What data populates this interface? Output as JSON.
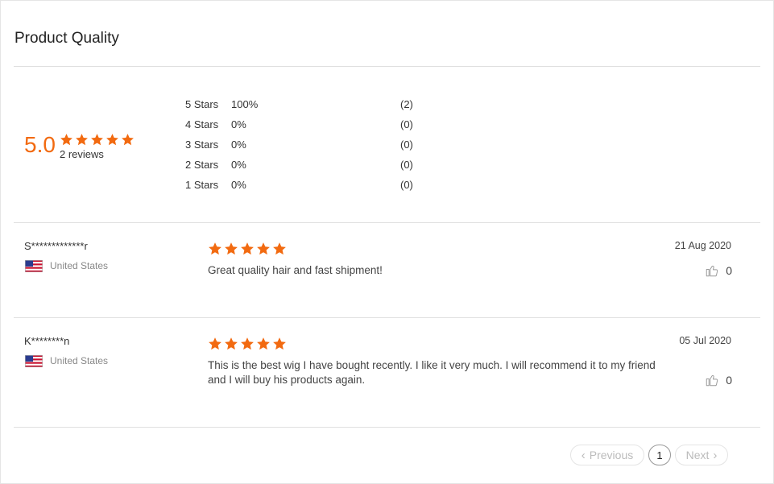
{
  "section": {
    "title": "Product Quality"
  },
  "summary": {
    "score": "5.0",
    "rating": 5,
    "reviews_label": "2 reviews",
    "breakdown": [
      {
        "stars": "5 Stars",
        "percent": "100%",
        "count": "(2)"
      },
      {
        "stars": "4 Stars",
        "percent": "0%",
        "count": "(0)"
      },
      {
        "stars": "3 Stars",
        "percent": "0%",
        "count": "(0)"
      },
      {
        "stars": "2 Stars",
        "percent": "0%",
        "count": "(0)"
      },
      {
        "stars": "1 Stars",
        "percent": "0%",
        "count": "(0)"
      }
    ]
  },
  "reviews": [
    {
      "name": "S*************r",
      "country": "United States",
      "rating": 5,
      "text": "Great quality hair and fast shipment!",
      "date": "21 Aug 2020",
      "likes": "0"
    },
    {
      "name": "K********n",
      "country": "United States",
      "rating": 5,
      "text": "This is the best wig I have bought recently. I like it very much. I will recommend it to my friend and I will buy his products again.",
      "date": "05 Jul 2020",
      "likes": "0"
    }
  ],
  "pagination": {
    "previous_label": "Previous",
    "current_page": "1",
    "next_label": "Next"
  },
  "colors": {
    "accent": "#f26a10",
    "divider": "#e0e0e0"
  },
  "icons": {
    "star": "star-icon",
    "like": "thumbs-up-icon",
    "flag": "us-flag-icon",
    "prev": "chevron-left-icon",
    "next": "chevron-right-icon"
  }
}
